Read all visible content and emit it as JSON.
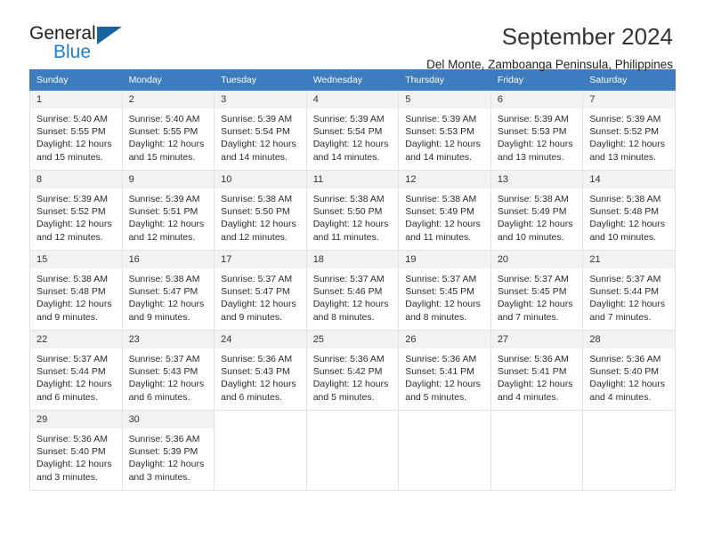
{
  "brand": {
    "name_top": "General",
    "name_bottom": "Blue",
    "accent_color": "#1c7fd0",
    "triangle_color": "#19639e"
  },
  "header": {
    "title": "September 2024",
    "subtitle": "Del Monte, Zamboanga Peninsula, Philippines"
  },
  "calendar": {
    "header_bg": "#3d7dbf",
    "daynum_bg": "#f2f2f2",
    "weekday_headers": [
      "Sunday",
      "Monday",
      "Tuesday",
      "Wednesday",
      "Thursday",
      "Friday",
      "Saturday"
    ],
    "weeks": [
      [
        {
          "day": "1",
          "sunrise": "Sunrise: 5:40 AM",
          "sunset": "Sunset: 5:55 PM",
          "daylight1": "Daylight: 12 hours",
          "daylight2": "and 15 minutes."
        },
        {
          "day": "2",
          "sunrise": "Sunrise: 5:40 AM",
          "sunset": "Sunset: 5:55 PM",
          "daylight1": "Daylight: 12 hours",
          "daylight2": "and 15 minutes."
        },
        {
          "day": "3",
          "sunrise": "Sunrise: 5:39 AM",
          "sunset": "Sunset: 5:54 PM",
          "daylight1": "Daylight: 12 hours",
          "daylight2": "and 14 minutes."
        },
        {
          "day": "4",
          "sunrise": "Sunrise: 5:39 AM",
          "sunset": "Sunset: 5:54 PM",
          "daylight1": "Daylight: 12 hours",
          "daylight2": "and 14 minutes."
        },
        {
          "day": "5",
          "sunrise": "Sunrise: 5:39 AM",
          "sunset": "Sunset: 5:53 PM",
          "daylight1": "Daylight: 12 hours",
          "daylight2": "and 14 minutes."
        },
        {
          "day": "6",
          "sunrise": "Sunrise: 5:39 AM",
          "sunset": "Sunset: 5:53 PM",
          "daylight1": "Daylight: 12 hours",
          "daylight2": "and 13 minutes."
        },
        {
          "day": "7",
          "sunrise": "Sunrise: 5:39 AM",
          "sunset": "Sunset: 5:52 PM",
          "daylight1": "Daylight: 12 hours",
          "daylight2": "and 13 minutes."
        }
      ],
      [
        {
          "day": "8",
          "sunrise": "Sunrise: 5:39 AM",
          "sunset": "Sunset: 5:52 PM",
          "daylight1": "Daylight: 12 hours",
          "daylight2": "and 12 minutes."
        },
        {
          "day": "9",
          "sunrise": "Sunrise: 5:39 AM",
          "sunset": "Sunset: 5:51 PM",
          "daylight1": "Daylight: 12 hours",
          "daylight2": "and 12 minutes."
        },
        {
          "day": "10",
          "sunrise": "Sunrise: 5:38 AM",
          "sunset": "Sunset: 5:50 PM",
          "daylight1": "Daylight: 12 hours",
          "daylight2": "and 12 minutes."
        },
        {
          "day": "11",
          "sunrise": "Sunrise: 5:38 AM",
          "sunset": "Sunset: 5:50 PM",
          "daylight1": "Daylight: 12 hours",
          "daylight2": "and 11 minutes."
        },
        {
          "day": "12",
          "sunrise": "Sunrise: 5:38 AM",
          "sunset": "Sunset: 5:49 PM",
          "daylight1": "Daylight: 12 hours",
          "daylight2": "and 11 minutes."
        },
        {
          "day": "13",
          "sunrise": "Sunrise: 5:38 AM",
          "sunset": "Sunset: 5:49 PM",
          "daylight1": "Daylight: 12 hours",
          "daylight2": "and 10 minutes."
        },
        {
          "day": "14",
          "sunrise": "Sunrise: 5:38 AM",
          "sunset": "Sunset: 5:48 PM",
          "daylight1": "Daylight: 12 hours",
          "daylight2": "and 10 minutes."
        }
      ],
      [
        {
          "day": "15",
          "sunrise": "Sunrise: 5:38 AM",
          "sunset": "Sunset: 5:48 PM",
          "daylight1": "Daylight: 12 hours",
          "daylight2": "and 9 minutes."
        },
        {
          "day": "16",
          "sunrise": "Sunrise: 5:38 AM",
          "sunset": "Sunset: 5:47 PM",
          "daylight1": "Daylight: 12 hours",
          "daylight2": "and 9 minutes."
        },
        {
          "day": "17",
          "sunrise": "Sunrise: 5:37 AM",
          "sunset": "Sunset: 5:47 PM",
          "daylight1": "Daylight: 12 hours",
          "daylight2": "and 9 minutes."
        },
        {
          "day": "18",
          "sunrise": "Sunrise: 5:37 AM",
          "sunset": "Sunset: 5:46 PM",
          "daylight1": "Daylight: 12 hours",
          "daylight2": "and 8 minutes."
        },
        {
          "day": "19",
          "sunrise": "Sunrise: 5:37 AM",
          "sunset": "Sunset: 5:45 PM",
          "daylight1": "Daylight: 12 hours",
          "daylight2": "and 8 minutes."
        },
        {
          "day": "20",
          "sunrise": "Sunrise: 5:37 AM",
          "sunset": "Sunset: 5:45 PM",
          "daylight1": "Daylight: 12 hours",
          "daylight2": "and 7 minutes."
        },
        {
          "day": "21",
          "sunrise": "Sunrise: 5:37 AM",
          "sunset": "Sunset: 5:44 PM",
          "daylight1": "Daylight: 12 hours",
          "daylight2": "and 7 minutes."
        }
      ],
      [
        {
          "day": "22",
          "sunrise": "Sunrise: 5:37 AM",
          "sunset": "Sunset: 5:44 PM",
          "daylight1": "Daylight: 12 hours",
          "daylight2": "and 6 minutes."
        },
        {
          "day": "23",
          "sunrise": "Sunrise: 5:37 AM",
          "sunset": "Sunset: 5:43 PM",
          "daylight1": "Daylight: 12 hours",
          "daylight2": "and 6 minutes."
        },
        {
          "day": "24",
          "sunrise": "Sunrise: 5:36 AM",
          "sunset": "Sunset: 5:43 PM",
          "daylight1": "Daylight: 12 hours",
          "daylight2": "and 6 minutes."
        },
        {
          "day": "25",
          "sunrise": "Sunrise: 5:36 AM",
          "sunset": "Sunset: 5:42 PM",
          "daylight1": "Daylight: 12 hours",
          "daylight2": "and 5 minutes."
        },
        {
          "day": "26",
          "sunrise": "Sunrise: 5:36 AM",
          "sunset": "Sunset: 5:41 PM",
          "daylight1": "Daylight: 12 hours",
          "daylight2": "and 5 minutes."
        },
        {
          "day": "27",
          "sunrise": "Sunrise: 5:36 AM",
          "sunset": "Sunset: 5:41 PM",
          "daylight1": "Daylight: 12 hours",
          "daylight2": "and 4 minutes."
        },
        {
          "day": "28",
          "sunrise": "Sunrise: 5:36 AM",
          "sunset": "Sunset: 5:40 PM",
          "daylight1": "Daylight: 12 hours",
          "daylight2": "and 4 minutes."
        }
      ],
      [
        {
          "day": "29",
          "sunrise": "Sunrise: 5:36 AM",
          "sunset": "Sunset: 5:40 PM",
          "daylight1": "Daylight: 12 hours",
          "daylight2": "and 3 minutes."
        },
        {
          "day": "30",
          "sunrise": "Sunrise: 5:36 AM",
          "sunset": "Sunset: 5:39 PM",
          "daylight1": "Daylight: 12 hours",
          "daylight2": "and 3 minutes."
        },
        {
          "day": "",
          "sunrise": "",
          "sunset": "",
          "daylight1": "",
          "daylight2": ""
        },
        {
          "day": "",
          "sunrise": "",
          "sunset": "",
          "daylight1": "",
          "daylight2": ""
        },
        {
          "day": "",
          "sunrise": "",
          "sunset": "",
          "daylight1": "",
          "daylight2": ""
        },
        {
          "day": "",
          "sunrise": "",
          "sunset": "",
          "daylight1": "",
          "daylight2": ""
        },
        {
          "day": "",
          "sunrise": "",
          "sunset": "",
          "daylight1": "",
          "daylight2": ""
        }
      ]
    ]
  }
}
